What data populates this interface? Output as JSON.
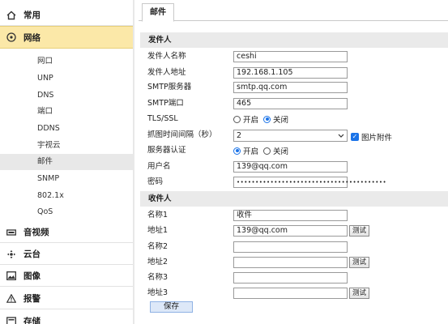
{
  "sidebar": {
    "categories": {
      "common": "常用",
      "network": "网络",
      "av": "音视频",
      "ptz": "云台",
      "image": "图像",
      "alarm": "报警",
      "storage": "存储"
    },
    "network_items": [
      "网口",
      "UNP",
      "DNS",
      "端口",
      "DDNS",
      "宇视云",
      "邮件",
      "SNMP",
      "802.1x",
      "QoS"
    ],
    "active_item": "邮件"
  },
  "tab": {
    "label": "邮件"
  },
  "sender": {
    "section_title": "发件人",
    "name_label": "发件人名称",
    "name_value": "ceshi",
    "address_label": "发件人地址",
    "address_value": "192.168.1.105",
    "smtp_server_label": "SMTP服务器",
    "smtp_server_value": "smtp.qq.com",
    "smtp_port_label": "SMTP端口",
    "smtp_port_value": "465",
    "tls_label": "TLS/SSL",
    "tls_on": "开启",
    "tls_off": "关闭",
    "tls_selected": "关闭",
    "interval_label": "抓图时间间隔（秒）",
    "interval_value": "2",
    "attach_label": "图片附件",
    "attach_checked": true,
    "auth_label": "服务器认证",
    "auth_on": "开启",
    "auth_off": "关闭",
    "auth_selected": "开启",
    "user_label": "用户名",
    "user_value": "139@qq.com",
    "pw_label": "密码",
    "pw_value": "••••••••••••••••••••••••••••••••••••••••"
  },
  "receiver": {
    "section_title": "收件人",
    "name1_label": "名称1",
    "name1_value": "收件",
    "addr1_label": "地址1",
    "addr1_value": "139@qq.com",
    "name2_label": "名称2",
    "name2_value": "",
    "addr2_label": "地址2",
    "addr2_value": "",
    "name3_label": "名称3",
    "name3_value": "",
    "addr3_label": "地址3",
    "addr3_value": "",
    "test_label": "测试"
  },
  "save_label": "保存",
  "colors": {
    "active_category": "#fbe8a8",
    "accent": "#1a73e8"
  }
}
